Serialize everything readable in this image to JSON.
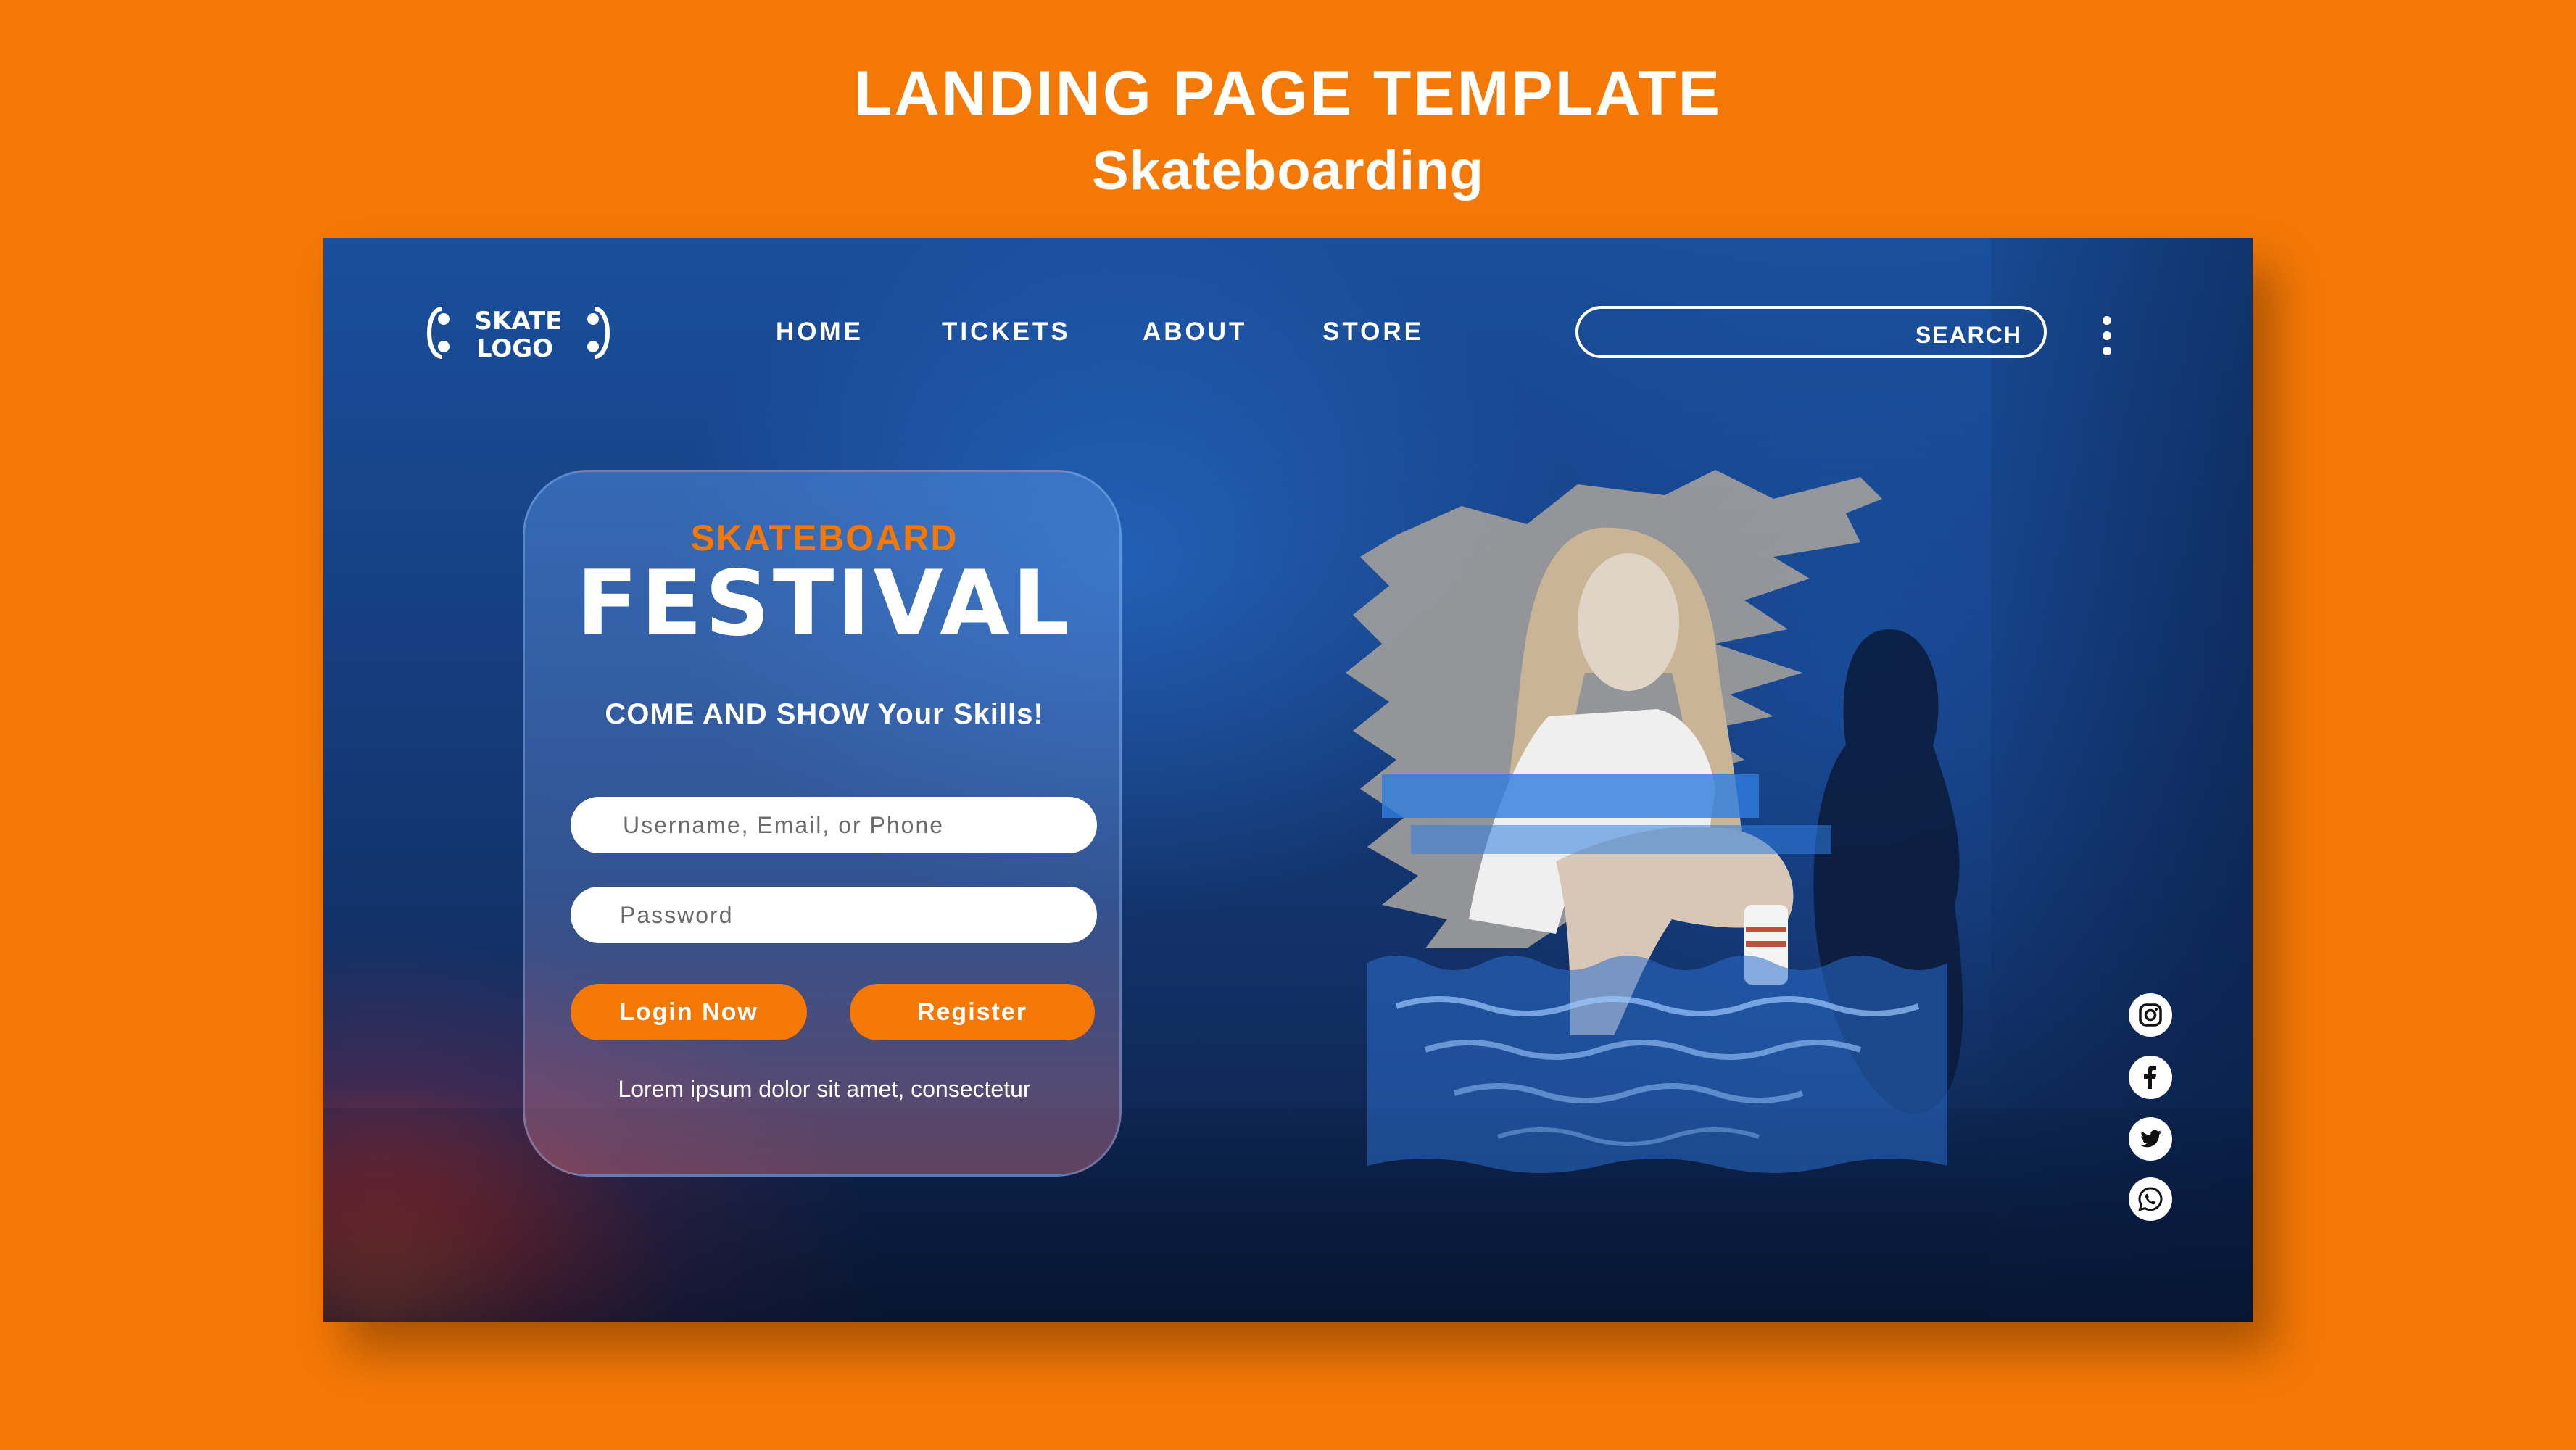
{
  "heading": {
    "title": "LANDING PAGE TEMPLATE",
    "subtitle": "Skateboarding"
  },
  "header": {
    "logo_text_line1": "SKATE",
    "logo_text_line2": "LOGO",
    "nav": [
      {
        "label": "HOME"
      },
      {
        "label": "TICKETS"
      },
      {
        "label": "ABOUT"
      },
      {
        "label": "STORE"
      }
    ],
    "search": {
      "label": "SEARCH",
      "value": ""
    }
  },
  "card": {
    "eyebrow": "SKATEBOARD",
    "headline": "FESTIVAL",
    "tagline": "COME AND SHOW Your Skills!",
    "username_placeholder": "Username, Email, or Phone",
    "password_placeholder": "Password",
    "login_label": "Login Now",
    "register_label": "Register",
    "footer_text": "Lorem ipsum dolor sit amet, consectetur"
  },
  "social": [
    {
      "icon": "instagram-icon"
    },
    {
      "icon": "facebook-icon"
    },
    {
      "icon": "twitter-icon"
    },
    {
      "icon": "whatsapp-icon"
    }
  ],
  "colors": {
    "accent": "#f47806",
    "background_blue": "#163f82",
    "text": "#ffffff"
  }
}
